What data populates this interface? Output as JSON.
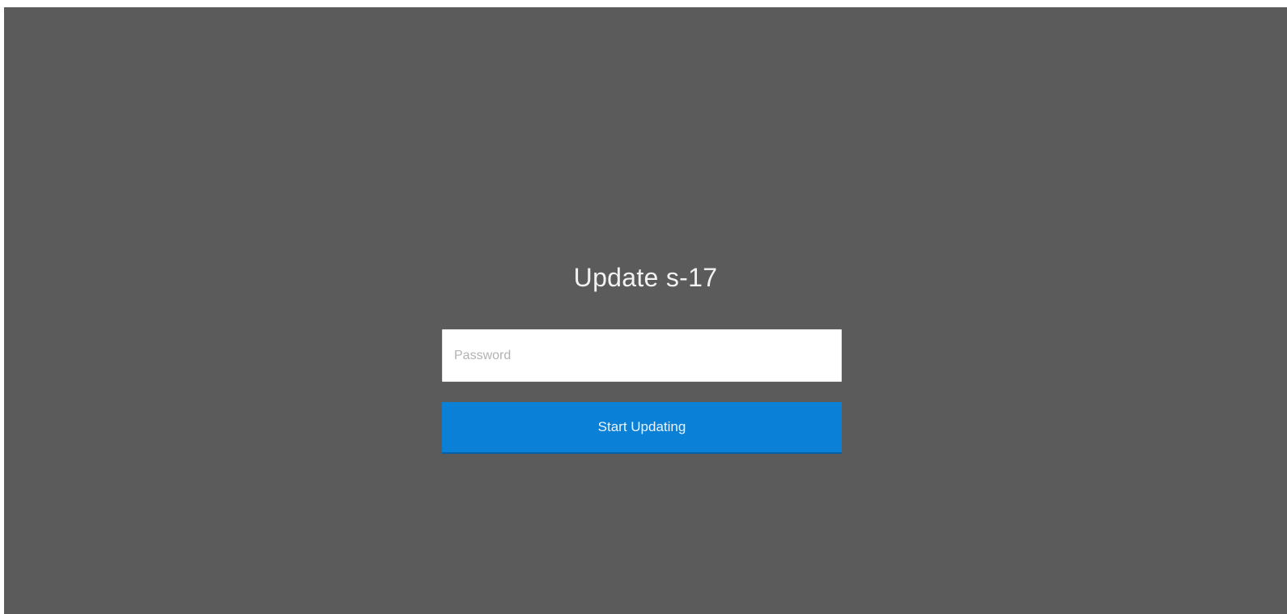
{
  "page": {
    "title": "Update s-17"
  },
  "form": {
    "password": {
      "value": "",
      "placeholder": "Password"
    },
    "submit_label": "Start Updating"
  },
  "colors": {
    "background": "#5b5b5b",
    "accent": "#0a80d6",
    "text": "#f2f2f2"
  }
}
